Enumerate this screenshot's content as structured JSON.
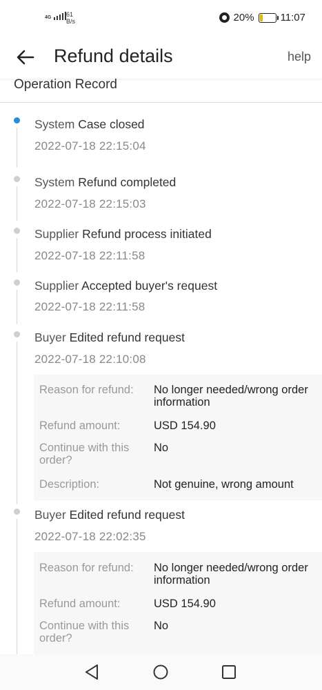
{
  "status_bar": {
    "network": "4G",
    "speed_value": "61",
    "speed_unit": "B/s",
    "battery": "20%",
    "time": "11:07",
    "icons": [
      "alarm-icon",
      "battery-icon"
    ]
  },
  "header": {
    "title": "Refund details",
    "help": "help",
    "back_icon": "arrow-left-icon"
  },
  "section": {
    "title": "Operation Record"
  },
  "records": [
    {
      "actor": "System",
      "action": "Case closed",
      "time": "2022-07-18 22:15:04"
    },
    {
      "actor": "System",
      "action": "Refund completed",
      "time": "2022-07-18 22:15:03"
    },
    {
      "actor": "Supplier",
      "action": "Refund process initiated",
      "time": "2022-07-18 22:11:58"
    },
    {
      "actor": "Supplier",
      "action": "Accepted buyer's request",
      "time": "2022-07-18 22:11:58"
    },
    {
      "actor": "Buyer",
      "action": "Edited refund request",
      "time": "2022-07-18 22:10:08",
      "details": [
        {
          "label": "Reason for refund:",
          "value": "No longer needed/wrong order information"
        },
        {
          "label": "Refund amount:",
          "value": "USD 154.90"
        },
        {
          "label": "Continue with this order?",
          "value": "No"
        },
        {
          "label": "Description:",
          "value": "Not genuine, wrong amount"
        }
      ]
    },
    {
      "actor": "Buyer",
      "action": "Edited refund request",
      "time": "2022-07-18 22:02:35",
      "details": [
        {
          "label": "Reason for refund:",
          "value": "No longer needed/wrong order information"
        },
        {
          "label": "Refund amount:",
          "value": "USD 154.90"
        },
        {
          "label": "Continue with this order?",
          "value": "No"
        }
      ]
    }
  ],
  "nav_bar": {
    "icons": [
      "back-triangle-icon",
      "home-circle-icon",
      "recents-square-icon"
    ]
  },
  "colors": {
    "active_dot": "#2a8bd6",
    "inactive_dot": "#cfcfcf",
    "detail_bg": "#f7f7f7",
    "label_gray": "#999999"
  }
}
